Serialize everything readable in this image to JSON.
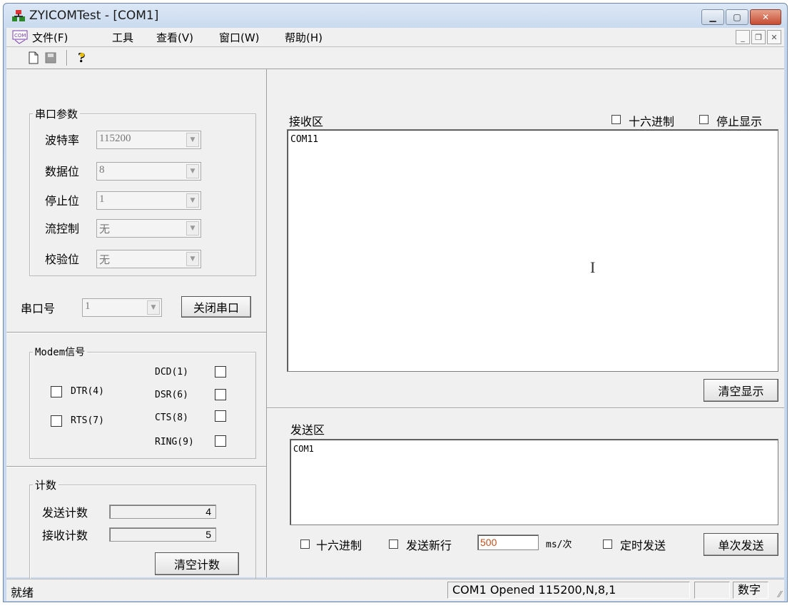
{
  "window": {
    "title": "ZYICOMTest - [COM1]"
  },
  "menu": {
    "file": "文件(F)",
    "tools": "工具",
    "view": "查看(V)",
    "window": "窗口(W)",
    "help": "帮助(H)"
  },
  "serial_params": {
    "title": "串口参数",
    "baud_label": "波特率",
    "baud_value": "115200",
    "data_bits_label": "数据位",
    "data_bits_value": "8",
    "stop_bits_label": "停止位",
    "stop_bits_value": "1",
    "flow_label": "流控制",
    "flow_value": "无",
    "parity_label": "校验位",
    "parity_value": "无"
  },
  "port": {
    "label": "串口号",
    "value": "1",
    "close_button": "关闭串口"
  },
  "modem": {
    "title": "Modem信号",
    "dtr": "DTR(4)",
    "rts": "RTS(7)",
    "dcd": "DCD(1)",
    "dsr": "DSR(6)",
    "cts": "CTS(8)",
    "ring": "RING(9)"
  },
  "count": {
    "title": "计数",
    "send_label": "发送计数",
    "send_value": "4",
    "recv_label": "接收计数",
    "recv_value": "5",
    "clear_button": "清空计数"
  },
  "receive": {
    "title": "接收区",
    "hex_label": "十六进制",
    "stop_display_label": "停止显示",
    "content": "COM11",
    "clear_button": "清空显示"
  },
  "send": {
    "title": "发送区",
    "content": "COM1",
    "hex_label": "十六进制",
    "newline_label": "发送新行",
    "interval_value": "500",
    "interval_unit": "ms/次",
    "timed_label": "定时发送",
    "send_button": "单次发送"
  },
  "status": {
    "ready": "就绪",
    "port_info": "COM1  Opened  115200,N,8,1",
    "num": "数字"
  }
}
